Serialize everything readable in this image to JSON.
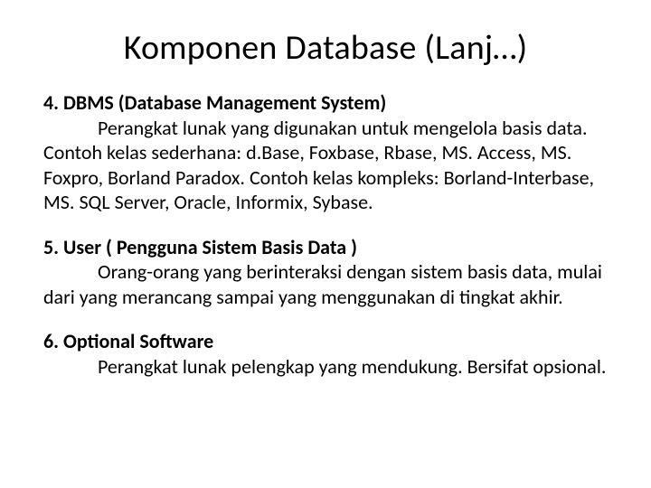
{
  "title": "Komponen Database (Lanj…)",
  "sections": [
    {
      "heading": "4. DBMS (Database Management System)",
      "body": "Perangkat lunak yang digunakan untuk mengelola basis data. Contoh kelas sederhana: d.Base, Foxbase, Rbase, MS. Access, MS. Foxpro, Borland Paradox. Contoh kelas kompleks: Borland-Interbase, MS. SQL Server, Oracle, Informix, Sybase."
    },
    {
      "heading": "5. User ( Pengguna Sistem Basis Data )",
      "body": "Orang-orang yang berinteraksi dengan sistem basis data, mulai dari yang merancang sampai yang menggunakan di tingkat akhir."
    },
    {
      "heading": "6. Optional Software",
      "body": "Perangkat lunak pelengkap yang mendukung. Bersifat opsional."
    }
  ]
}
